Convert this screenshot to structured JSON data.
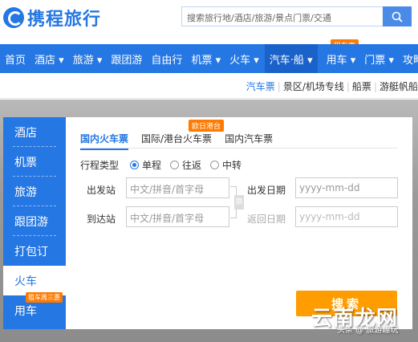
{
  "header": {
    "logo_text": "携程旅行",
    "search_placeholder": "搜索旅行地/酒店/旅游/景点门票/交通"
  },
  "nav": {
    "items": [
      "首页",
      "酒店",
      "旅游",
      "跟团游",
      "自由行",
      "机票",
      "火车",
      "汽车·船",
      "用车",
      "门票",
      "攻略"
    ],
    "tag": "租车惠"
  },
  "subnav": {
    "items": [
      "汽车票",
      "景区/机场专线",
      "船票",
      "游艇帆船"
    ]
  },
  "sidebar": {
    "items": [
      "酒店",
      "机票",
      "旅游",
      "跟团游",
      "打包订",
      "火车",
      "用车"
    ],
    "tag": "租车周三惠"
  },
  "panel": {
    "tabs": [
      "国内火车票",
      "国际/港台火车票",
      "国内汽车票"
    ],
    "tab_tag": "欧日港台",
    "trip_type_label": "行程类型",
    "trip_options": [
      "单程",
      "往返",
      "中转"
    ],
    "from_label": "出发站",
    "from_placeholder": "中文/拼音/首字母",
    "depart_label": "出发日期",
    "depart_placeholder": "yyyy-mm-dd",
    "to_label": "到达站",
    "to_placeholder": "中文/拼音/首字母",
    "return_label": "返回日期",
    "return_placeholder": "yyyy-mm-dd",
    "swap_label": "换",
    "search_label": "搜索"
  },
  "watermark": {
    "text": "云南龙网",
    "sub": "头条 @ 旅游趣玩"
  }
}
